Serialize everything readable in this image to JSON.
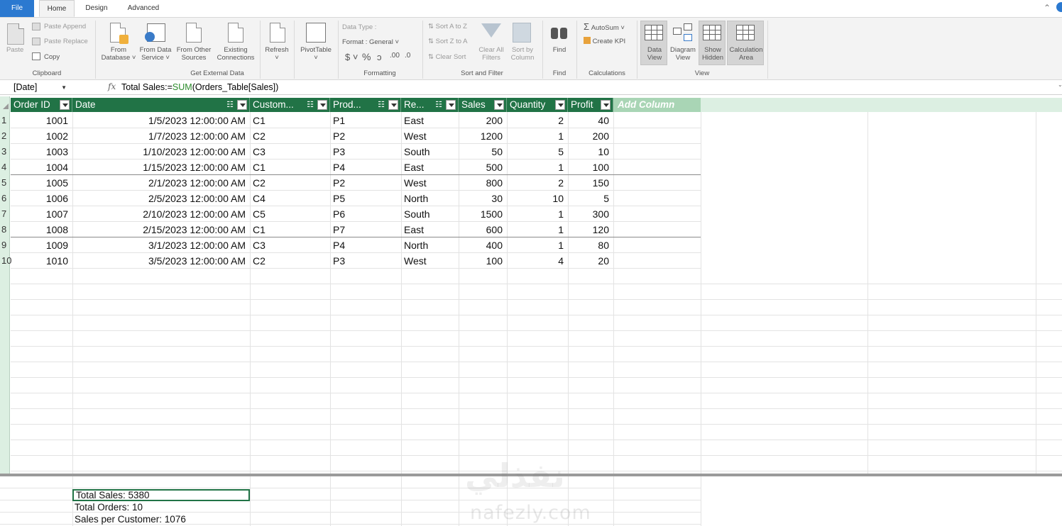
{
  "tabs": {
    "file": "File",
    "home": "Home",
    "design": "Design",
    "advanced": "Advanced"
  },
  "ribbon": {
    "clipboard": {
      "paste": "Paste",
      "paste_append": "Paste Append",
      "paste_replace": "Paste Replace",
      "copy": "Copy",
      "group": "Clipboard"
    },
    "external": {
      "from_database_1": "From",
      "from_database_2": "Database",
      "from_data_service_1": "From Data",
      "from_data_service_2": "Service",
      "from_other_1": "From Other",
      "from_other_2": "Sources",
      "existing_1": "Existing",
      "existing_2": "Connections",
      "refresh": "Refresh",
      "pivottable": "PivotTable",
      "group": "Get External Data"
    },
    "formatting": {
      "data_type": "Data Type :",
      "format": "Format : General",
      "currency": "$",
      "percent": "%",
      "comma": "ɔ",
      "inc_dec": ".00",
      "dec_dec": ".0",
      "group": "Formatting"
    },
    "sort_filter": {
      "sort_a_z": "Sort A to Z",
      "sort_z_a": "Sort Z to A",
      "clear_sort": "Clear Sort",
      "clear_all_1": "Clear All",
      "clear_all_2": "Filters",
      "sort_by_1": "Sort by",
      "sort_by_2": "Column",
      "group": "Sort and Filter"
    },
    "find": {
      "find": "Find",
      "group": "Find"
    },
    "calculations": {
      "autosum": "AutoSum",
      "create_kpi": "Create KPI",
      "group": "Calculations"
    },
    "view": {
      "data_view_1": "Data",
      "data_view_2": "View",
      "diagram_view_1": "Diagram",
      "diagram_view_2": "View",
      "show_hidden_1": "Show",
      "show_hidden_2": "Hidden",
      "calc_area_1": "Calculation",
      "calc_area_2": "Area",
      "group": "View"
    }
  },
  "formula_bar": {
    "name_box": "[Date]",
    "fx": "fx",
    "formula_prefix": "Total Sales:=",
    "formula_fn": "SUM",
    "formula_suffix": "(Orders_Table[Sales])"
  },
  "table": {
    "headers": [
      "Order ID",
      "Date",
      "Custom...",
      "Prod...",
      "Re...",
      "Sales",
      "Quantity",
      "Profit"
    ],
    "add_column": "Add Column",
    "rows": [
      [
        "1001",
        "1/5/2023 12:00:00 AM",
        "C1",
        "P1",
        "East",
        "200",
        "2",
        "40"
      ],
      [
        "1002",
        "1/7/2023 12:00:00 AM",
        "C2",
        "P2",
        "West",
        "1200",
        "1",
        "200"
      ],
      [
        "1003",
        "1/10/2023 12:00:00 AM",
        "C3",
        "P3",
        "South",
        "50",
        "5",
        "10"
      ],
      [
        "1004",
        "1/15/2023 12:00:00 AM",
        "C1",
        "P4",
        "East",
        "500",
        "1",
        "100"
      ],
      [
        "1005",
        "2/1/2023 12:00:00 AM",
        "C2",
        "P2",
        "West",
        "800",
        "2",
        "150"
      ],
      [
        "1006",
        "2/5/2023 12:00:00 AM",
        "C4",
        "P5",
        "North",
        "30",
        "10",
        "5"
      ],
      [
        "1007",
        "2/10/2023 12:00:00 AM",
        "C5",
        "P6",
        "South",
        "1500",
        "1",
        "300"
      ],
      [
        "1008",
        "2/15/2023 12:00:00 AM",
        "C1",
        "P7",
        "East",
        "600",
        "1",
        "120"
      ],
      [
        "1009",
        "3/1/2023 12:00:00 AM",
        "C3",
        "P4",
        "North",
        "400",
        "1",
        "80"
      ],
      [
        "1010",
        "3/5/2023 12:00:00 AM",
        "C2",
        "P3",
        "West",
        "100",
        "4",
        "20"
      ]
    ],
    "row_numbers": [
      "1",
      "2",
      "3",
      "4",
      "5",
      "6",
      "7",
      "8",
      "9",
      "10"
    ]
  },
  "measures": [
    "Total Sales: 5380",
    "Total Orders: 10",
    "Sales per Customer: 1076"
  ],
  "watermark": {
    "arabic": "نفذلي",
    "latin": "nafezly.com"
  },
  "colors": {
    "header_green": "#217346",
    "file_tab_blue": "#2b79d0",
    "add_column_bg": "#a9d5b5"
  }
}
